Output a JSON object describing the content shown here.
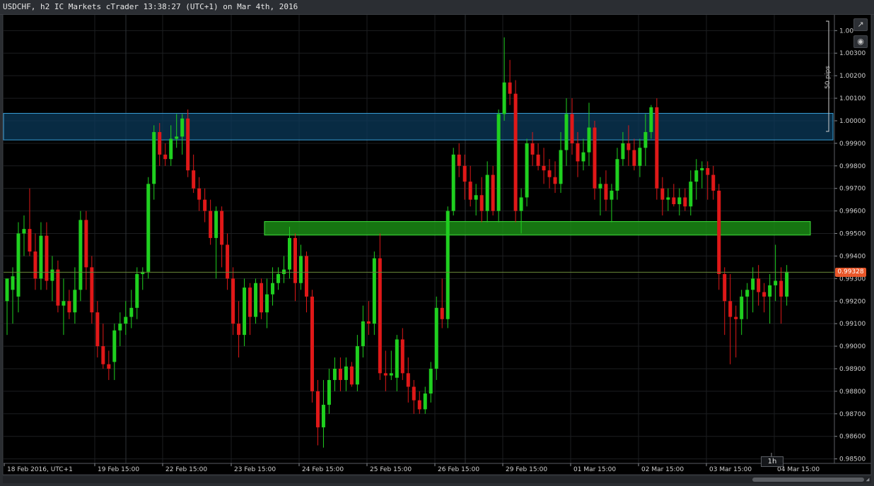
{
  "window": {
    "title": "USDCHF, h2 IC Markets cTrader 13:38:27 (UTC+1) on Mar 4th, 2016"
  },
  "toolbar": {
    "expand_icon": "expand-icon",
    "screenshot_icon": "camera-icon"
  },
  "price_scale": {
    "labels": [
      "1.00",
      "1.00300",
      "1.00200",
      "1.00100",
      "1.00000",
      "0.99900",
      "0.99800",
      "0.99700",
      "0.99600",
      "0.99500",
      "0.99400",
      "0.99300",
      "0.99200",
      "0.99100",
      "0.99000",
      "0.98900",
      "0.98800",
      "0.98700",
      "0.98600",
      "0.98500"
    ],
    "current_price": "0.99328",
    "pips_label": "50 pips"
  },
  "time_scale": {
    "labels": [
      "18 Feb 2016, UTC+1",
      "19 Feb 15:00",
      "22 Feb 15:00",
      "23 Feb 15:00",
      "24 Feb 15:00",
      "25 Feb 15:00",
      "26 Feb 15:00",
      "29 Feb 15:00",
      "01 Mar 15:00",
      "02 Mar 15:00",
      "03 Mar 15:00",
      "04 Mar 15:00"
    ],
    "timeframe": "1h"
  },
  "colors": {
    "background": "#000000",
    "bull": "#1fd01f",
    "bear": "#e01818",
    "grid": "#1c1e21",
    "resistance_zone": "#0b3a5a",
    "support_zone": "#1a8a14",
    "price_line": "#6a8a3a",
    "price_tag": "#e8572a"
  },
  "chart_data": {
    "type": "candlestick",
    "symbol": "USDCHF",
    "timeframe": "h2",
    "ylim": [
      0.9848,
      1.0047
    ],
    "candles": [
      {
        "o": 0.992,
        "h": 0.993,
        "l": 0.9905,
        "c": 0.993
      },
      {
        "o": 0.9925,
        "h": 0.9935,
        "l": 0.991,
        "c": 0.9931
      },
      {
        "o": 0.9922,
        "h": 0.9955,
        "l": 0.9915,
        "c": 0.995
      },
      {
        "o": 0.995,
        "h": 0.9958,
        "l": 0.994,
        "c": 0.9952
      },
      {
        "o": 0.9952,
        "h": 0.997,
        "l": 0.994,
        "c": 0.9942
      },
      {
        "o": 0.9942,
        "h": 0.995,
        "l": 0.9925,
        "c": 0.993
      },
      {
        "o": 0.993,
        "h": 0.9955,
        "l": 0.9925,
        "c": 0.9949
      },
      {
        "o": 0.9949,
        "h": 0.9955,
        "l": 0.9925,
        "c": 0.9929
      },
      {
        "o": 0.9929,
        "h": 0.994,
        "l": 0.992,
        "c": 0.9934
      },
      {
        "o": 0.9934,
        "h": 0.9938,
        "l": 0.9915,
        "c": 0.9918
      },
      {
        "o": 0.9918,
        "h": 0.993,
        "l": 0.9905,
        "c": 0.992
      },
      {
        "o": 0.992,
        "h": 0.9925,
        "l": 0.9912,
        "c": 0.9915
      },
      {
        "o": 0.9915,
        "h": 0.9935,
        "l": 0.991,
        "c": 0.9925
      },
      {
        "o": 0.9925,
        "h": 0.996,
        "l": 0.992,
        "c": 0.9956
      },
      {
        "o": 0.9956,
        "h": 0.996,
        "l": 0.9925,
        "c": 0.9935
      },
      {
        "o": 0.9935,
        "h": 0.994,
        "l": 0.991,
        "c": 0.9915
      },
      {
        "o": 0.9915,
        "h": 0.992,
        "l": 0.9895,
        "c": 0.99
      },
      {
        "o": 0.99,
        "h": 0.991,
        "l": 0.989,
        "c": 0.9892
      },
      {
        "o": 0.9892,
        "h": 0.9898,
        "l": 0.9885,
        "c": 0.989
      },
      {
        "o": 0.9893,
        "h": 0.991,
        "l": 0.9885,
        "c": 0.9907
      },
      {
        "o": 0.9907,
        "h": 0.9915,
        "l": 0.99,
        "c": 0.991
      },
      {
        "o": 0.991,
        "h": 0.992,
        "l": 0.9905,
        "c": 0.9913
      },
      {
        "o": 0.9913,
        "h": 0.9925,
        "l": 0.9908,
        "c": 0.9917
      },
      {
        "o": 0.9917,
        "h": 0.9935,
        "l": 0.9912,
        "c": 0.9932
      },
      {
        "o": 0.9932,
        "h": 0.9935,
        "l": 0.9925,
        "c": 0.9933
      },
      {
        "o": 0.9933,
        "h": 0.9975,
        "l": 0.993,
        "c": 0.9972
      },
      {
        "o": 0.9972,
        "h": 0.9998,
        "l": 0.9965,
        "c": 0.9995
      },
      {
        "o": 0.9995,
        "h": 0.9999,
        "l": 0.998,
        "c": 0.9985
      },
      {
        "o": 0.9985,
        "h": 0.999,
        "l": 0.998,
        "c": 0.9983
      },
      {
        "o": 0.9983,
        "h": 0.9998,
        "l": 0.998,
        "c": 0.9992
      },
      {
        "o": 0.9992,
        "h": 1.0003,
        "l": 0.9988,
        "c": 0.9993
      },
      {
        "o": 0.9993,
        "h": 1.0003,
        "l": 0.9985,
        "c": 1.0001
      },
      {
        "o": 1.0001,
        "h": 1.0005,
        "l": 0.9975,
        "c": 0.9978
      },
      {
        "o": 0.9978,
        "h": 0.9985,
        "l": 0.9968,
        "c": 0.997
      },
      {
        "o": 0.997,
        "h": 0.9975,
        "l": 0.996,
        "c": 0.9965
      },
      {
        "o": 0.9965,
        "h": 0.997,
        "l": 0.9955,
        "c": 0.996
      },
      {
        "o": 0.996,
        "h": 0.9965,
        "l": 0.9945,
        "c": 0.9948
      },
      {
        "o": 0.9948,
        "h": 0.9962,
        "l": 0.993,
        "c": 0.996
      },
      {
        "o": 0.996,
        "h": 0.9962,
        "l": 0.9935,
        "c": 0.9945
      },
      {
        "o": 0.9945,
        "h": 0.995,
        "l": 0.9925,
        "c": 0.993
      },
      {
        "o": 0.993,
        "h": 0.9935,
        "l": 0.9905,
        "c": 0.991
      },
      {
        "o": 0.991,
        "h": 0.992,
        "l": 0.9895,
        "c": 0.9905
      },
      {
        "o": 0.9905,
        "h": 0.993,
        "l": 0.99,
        "c": 0.9926
      },
      {
        "o": 0.9926,
        "h": 0.9928,
        "l": 0.9905,
        "c": 0.9913
      },
      {
        "o": 0.9913,
        "h": 0.993,
        "l": 0.991,
        "c": 0.9928
      },
      {
        "o": 0.9928,
        "h": 0.993,
        "l": 0.9912,
        "c": 0.9915
      },
      {
        "o": 0.9915,
        "h": 0.993,
        "l": 0.9908,
        "c": 0.9923
      },
      {
        "o": 0.9923,
        "h": 0.9935,
        "l": 0.9918,
        "c": 0.9928
      },
      {
        "o": 0.9928,
        "h": 0.9935,
        "l": 0.9925,
        "c": 0.9932
      },
      {
        "o": 0.9932,
        "h": 0.994,
        "l": 0.9928,
        "c": 0.9934
      },
      {
        "o": 0.9934,
        "h": 0.9953,
        "l": 0.993,
        "c": 0.9948
      },
      {
        "o": 0.9948,
        "h": 0.995,
        "l": 0.992,
        "c": 0.9928
      },
      {
        "o": 0.9928,
        "h": 0.9945,
        "l": 0.9925,
        "c": 0.994
      },
      {
        "o": 0.994,
        "h": 0.9942,
        "l": 0.9915,
        "c": 0.9922
      },
      {
        "o": 0.9922,
        "h": 0.9925,
        "l": 0.9875,
        "c": 0.988
      },
      {
        "o": 0.988,
        "h": 0.9885,
        "l": 0.9856,
        "c": 0.9864
      },
      {
        "o": 0.9864,
        "h": 0.9885,
        "l": 0.9855,
        "c": 0.9874
      },
      {
        "o": 0.9874,
        "h": 0.989,
        "l": 0.987,
        "c": 0.9885
      },
      {
        "o": 0.9885,
        "h": 0.9895,
        "l": 0.988,
        "c": 0.989
      },
      {
        "o": 0.989,
        "h": 0.9895,
        "l": 0.988,
        "c": 0.9885
      },
      {
        "o": 0.9885,
        "h": 0.9895,
        "l": 0.988,
        "c": 0.9891
      },
      {
        "o": 0.9891,
        "h": 0.9893,
        "l": 0.9882,
        "c": 0.9883
      },
      {
        "o": 0.9883,
        "h": 0.9905,
        "l": 0.988,
        "c": 0.99
      },
      {
        "o": 0.99,
        "h": 0.9918,
        "l": 0.9895,
        "c": 0.9911
      },
      {
        "o": 0.9911,
        "h": 0.992,
        "l": 0.9905,
        "c": 0.991
      },
      {
        "o": 0.991,
        "h": 0.9942,
        "l": 0.9905,
        "c": 0.9939
      },
      {
        "o": 0.9939,
        "h": 0.995,
        "l": 0.9885,
        "c": 0.9888
      },
      {
        "o": 0.9888,
        "h": 0.9898,
        "l": 0.988,
        "c": 0.9887
      },
      {
        "o": 0.9887,
        "h": 0.9898,
        "l": 0.9885,
        "c": 0.9888
      },
      {
        "o": 0.9886,
        "h": 0.9905,
        "l": 0.988,
        "c": 0.9903
      },
      {
        "o": 0.9903,
        "h": 0.9908,
        "l": 0.9885,
        "c": 0.9888
      },
      {
        "o": 0.9888,
        "h": 0.9895,
        "l": 0.9875,
        "c": 0.9882
      },
      {
        "o": 0.9882,
        "h": 0.9885,
        "l": 0.987,
        "c": 0.9876
      },
      {
        "o": 0.9876,
        "h": 0.988,
        "l": 0.987,
        "c": 0.9872
      },
      {
        "o": 0.9872,
        "h": 0.9882,
        "l": 0.987,
        "c": 0.9879
      },
      {
        "o": 0.9879,
        "h": 0.9893,
        "l": 0.9875,
        "c": 0.989
      },
      {
        "o": 0.989,
        "h": 0.9922,
        "l": 0.9885,
        "c": 0.9917
      },
      {
        "o": 0.9917,
        "h": 0.993,
        "l": 0.9908,
        "c": 0.9912
      },
      {
        "o": 0.9912,
        "h": 0.9962,
        "l": 0.9908,
        "c": 0.996
      },
      {
        "o": 0.996,
        "h": 0.9988,
        "l": 0.9958,
        "c": 0.9985
      },
      {
        "o": 0.9985,
        "h": 0.999,
        "l": 0.9975,
        "c": 0.998
      },
      {
        "o": 0.998,
        "h": 0.9985,
        "l": 0.9965,
        "c": 0.9973
      },
      {
        "o": 0.9973,
        "h": 0.998,
        "l": 0.9962,
        "c": 0.9965
      },
      {
        "o": 0.9965,
        "h": 0.9972,
        "l": 0.9958,
        "c": 0.9967
      },
      {
        "o": 0.9967,
        "h": 0.9975,
        "l": 0.9955,
        "c": 0.996
      },
      {
        "o": 0.996,
        "h": 0.9982,
        "l": 0.9955,
        "c": 0.9976
      },
      {
        "o": 0.9976,
        "h": 0.998,
        "l": 0.9958,
        "c": 0.996
      },
      {
        "o": 0.996,
        "h": 1.0005,
        "l": 0.9955,
        "c": 1.0003
      },
      {
        "o": 1.0003,
        "h": 1.0037,
        "l": 1.0,
        "c": 1.0017
      },
      {
        "o": 1.0017,
        "h": 1.0027,
        "l": 1.0007,
        "c": 1.0012
      },
      {
        "o": 1.0012,
        "h": 1.0018,
        "l": 0.9955,
        "c": 0.996
      },
      {
        "o": 0.996,
        "h": 0.997,
        "l": 0.995,
        "c": 0.9966
      },
      {
        "o": 0.9966,
        "h": 0.9992,
        "l": 0.9962,
        "c": 0.999
      },
      {
        "o": 0.999,
        "h": 0.9995,
        "l": 0.998,
        "c": 0.9985
      },
      {
        "o": 0.9985,
        "h": 0.999,
        "l": 0.9978,
        "c": 0.998
      },
      {
        "o": 0.998,
        "h": 0.9988,
        "l": 0.9972,
        "c": 0.9978
      },
      {
        "o": 0.9978,
        "h": 0.9983,
        "l": 0.997,
        "c": 0.9975
      },
      {
        "o": 0.9975,
        "h": 0.9982,
        "l": 0.9968,
        "c": 0.9972
      },
      {
        "o": 0.9972,
        "h": 0.9995,
        "l": 0.9968,
        "c": 0.9987
      },
      {
        "o": 0.9987,
        "h": 1.001,
        "l": 0.998,
        "c": 1.0003
      },
      {
        "o": 1.0003,
        "h": 1.001,
        "l": 0.9985,
        "c": 0.999
      },
      {
        "o": 0.999,
        "h": 0.9995,
        "l": 0.9975,
        "c": 0.9982
      },
      {
        "o": 0.9982,
        "h": 0.9992,
        "l": 0.9978,
        "c": 0.9986
      },
      {
        "o": 0.9986,
        "h": 1.0008,
        "l": 0.998,
        "c": 0.9997
      },
      {
        "o": 0.9997,
        "h": 1.0,
        "l": 0.9965,
        "c": 0.997
      },
      {
        "o": 0.997,
        "h": 0.9975,
        "l": 0.9958,
        "c": 0.9972
      },
      {
        "o": 0.9972,
        "h": 0.9978,
        "l": 0.996,
        "c": 0.9965
      },
      {
        "o": 0.9965,
        "h": 0.9972,
        "l": 0.9955,
        "c": 0.9969
      },
      {
        "o": 0.9969,
        "h": 0.9988,
        "l": 0.9965,
        "c": 0.9983
      },
      {
        "o": 0.9983,
        "h": 0.9995,
        "l": 0.998,
        "c": 0.999
      },
      {
        "o": 0.999,
        "h": 0.9998,
        "l": 0.998,
        "c": 0.9987
      },
      {
        "o": 0.9987,
        "h": 0.9992,
        "l": 0.9978,
        "c": 0.998
      },
      {
        "o": 0.998,
        "h": 0.9992,
        "l": 0.9975,
        "c": 0.9988
      },
      {
        "o": 0.9988,
        "h": 1.0003,
        "l": 0.998,
        "c": 0.9995
      },
      {
        "o": 0.9995,
        "h": 1.0007,
        "l": 0.9992,
        "c": 1.0006
      },
      {
        "o": 1.0006,
        "h": 1.001,
        "l": 0.9965,
        "c": 0.997
      },
      {
        "o": 0.997,
        "h": 0.9975,
        "l": 0.9958,
        "c": 0.9965
      },
      {
        "o": 0.9965,
        "h": 0.997,
        "l": 0.996,
        "c": 0.9966
      },
      {
        "o": 0.9966,
        "h": 0.9972,
        "l": 0.9962,
        "c": 0.9963
      },
      {
        "o": 0.9963,
        "h": 0.997,
        "l": 0.9958,
        "c": 0.9966
      },
      {
        "o": 0.9966,
        "h": 0.997,
        "l": 0.996,
        "c": 0.9962
      },
      {
        "o": 0.9962,
        "h": 0.9978,
        "l": 0.9958,
        "c": 0.9973
      },
      {
        "o": 0.9973,
        "h": 0.9983,
        "l": 0.9965,
        "c": 0.9978
      },
      {
        "o": 0.9978,
        "h": 0.9982,
        "l": 0.997,
        "c": 0.9979
      },
      {
        "o": 0.9979,
        "h": 0.9982,
        "l": 0.9965,
        "c": 0.9976
      },
      {
        "o": 0.9976,
        "h": 0.998,
        "l": 0.9965,
        "c": 0.9969
      },
      {
        "o": 0.9969,
        "h": 0.9972,
        "l": 0.9925,
        "c": 0.9932
      },
      {
        "o": 0.9932,
        "h": 0.9935,
        "l": 0.9905,
        "c": 0.992
      },
      {
        "o": 0.992,
        "h": 0.9932,
        "l": 0.9892,
        "c": 0.9913
      },
      {
        "o": 0.9913,
        "h": 0.9918,
        "l": 0.9895,
        "c": 0.9912
      },
      {
        "o": 0.9912,
        "h": 0.9925,
        "l": 0.9905,
        "c": 0.9922
      },
      {
        "o": 0.9922,
        "h": 0.9928,
        "l": 0.9912,
        "c": 0.9925
      },
      {
        "o": 0.9925,
        "h": 0.9935,
        "l": 0.9915,
        "c": 0.993
      },
      {
        "o": 0.993,
        "h": 0.9936,
        "l": 0.9918,
        "c": 0.9924
      },
      {
        "o": 0.9924,
        "h": 0.9928,
        "l": 0.9915,
        "c": 0.9922
      },
      {
        "o": 0.9922,
        "h": 0.9932,
        "l": 0.991,
        "c": 0.9927
      },
      {
        "o": 0.9927,
        "h": 0.9945,
        "l": 0.992,
        "c": 0.9929
      },
      {
        "o": 0.9929,
        "h": 0.9935,
        "l": 0.991,
        "c": 0.9922
      },
      {
        "o": 0.9922,
        "h": 0.9936,
        "l": 0.9918,
        "c": 0.9933
      }
    ],
    "zones": [
      {
        "label": "resistance",
        "from": 0.99915,
        "to": 1.00033
      },
      {
        "label": "support",
        "from": 0.99493,
        "to": 0.99553
      }
    ],
    "current_price": 0.99328,
    "grid": true
  }
}
